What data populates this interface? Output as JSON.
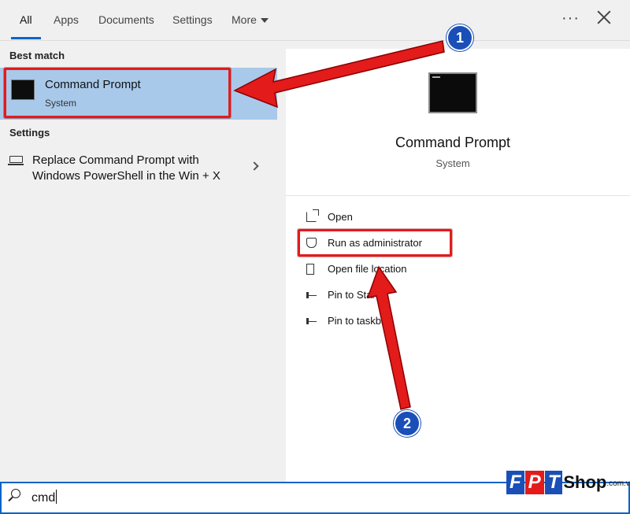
{
  "tabs": [
    {
      "label": "All",
      "active": true
    },
    {
      "label": "Apps"
    },
    {
      "label": "Documents"
    },
    {
      "label": "Settings"
    },
    {
      "label": "More"
    }
  ],
  "window": {
    "menu_icon": "ellipsis-icon",
    "close_icon": "close-icon"
  },
  "left": {
    "best_match_heading": "Best match",
    "best_match": {
      "title": "Command Prompt",
      "subtitle": "System",
      "icon": "command-prompt-icon"
    },
    "settings_heading": "Settings",
    "setting_item": {
      "text": "Replace Command Prompt with Windows PowerShell in the Win + X",
      "icon": "laptop-icon"
    }
  },
  "details": {
    "title": "Command Prompt",
    "subtitle": "System",
    "actions": [
      {
        "label": "Open",
        "icon": "open-icon"
      },
      {
        "label": "Run as administrator",
        "icon": "shield-icon"
      },
      {
        "label": "Open file location",
        "icon": "folder-icon"
      },
      {
        "label": "Pin to Start",
        "icon": "pin-icon"
      },
      {
        "label": "Pin to taskbar",
        "icon": "pin-icon"
      }
    ]
  },
  "search": {
    "value": "cmd"
  },
  "annotations": {
    "badge_1": "1",
    "badge_2": "2",
    "highlight_color": "#e31b1b",
    "badge_color": "#1a4fb8"
  },
  "watermark": {
    "f": "F",
    "p": "P",
    "t": "T",
    "shop": "Shop",
    "domain": ".com.vn",
    "colors": [
      "#1a4fb8",
      "#e31b1b",
      "#1a4fb8"
    ]
  }
}
